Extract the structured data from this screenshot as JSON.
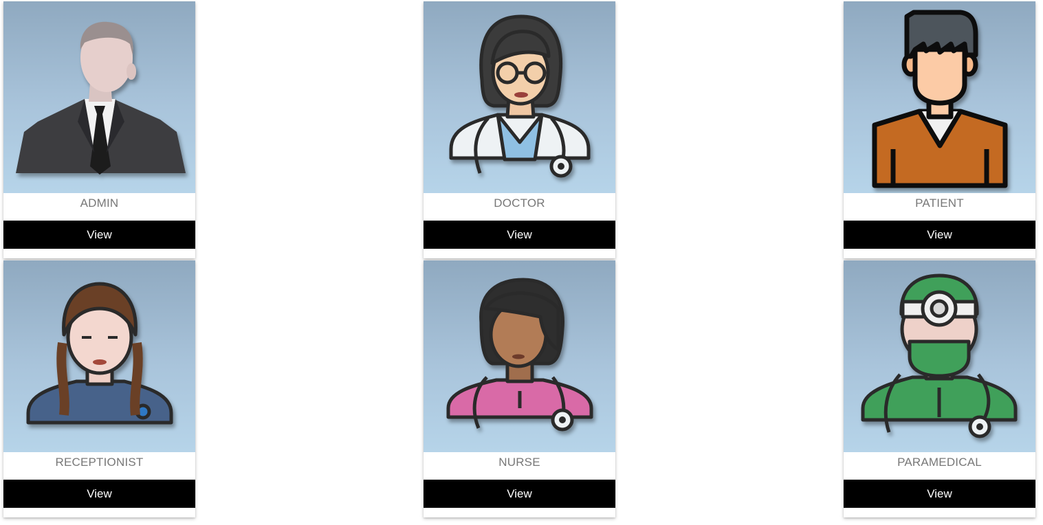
{
  "cards": [
    {
      "role": "ADMIN",
      "button": "View",
      "avatar_icon": "admin-businessman-icon"
    },
    {
      "role": "DOCTOR",
      "button": "View",
      "avatar_icon": "doctor-woman-icon"
    },
    {
      "role": "PATIENT",
      "button": "View",
      "avatar_icon": "patient-man-icon"
    },
    {
      "role": "RECEPTIONIST",
      "button": "View",
      "avatar_icon": "receptionist-woman-icon"
    },
    {
      "role": "NURSE",
      "button": "View",
      "avatar_icon": "nurse-woman-icon"
    },
    {
      "role": "PARAMEDICAL",
      "button": "View",
      "avatar_icon": "paramedical-surgeon-icon"
    }
  ],
  "colors": {
    "button_bg": "#000000",
    "button_text": "#ffffff",
    "role_text": "#777777",
    "avatar_bg_top": "#8fa9c0",
    "avatar_bg_bottom": "#b6d4e9"
  }
}
